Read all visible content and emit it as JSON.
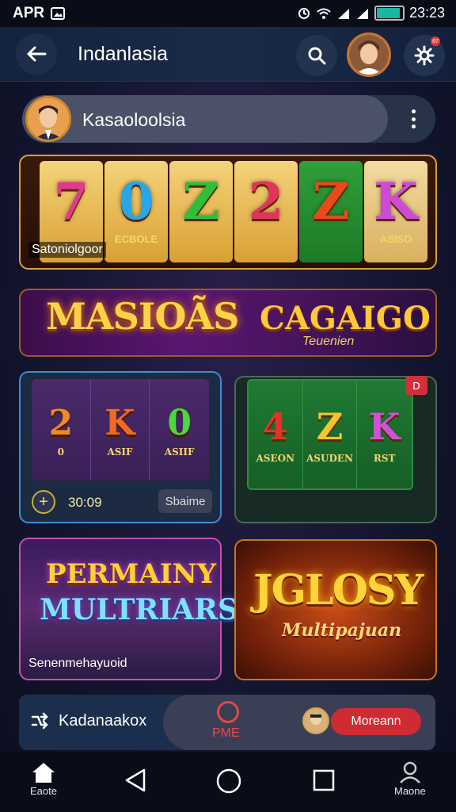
{
  "status_bar": {
    "carrier": "APR",
    "time": "23:23",
    "battery_level": 0.9
  },
  "header": {
    "title": "Indanlasia",
    "notification_count": "67"
  },
  "profile": {
    "name": "Kasaoloolsia"
  },
  "slot_banner": {
    "symbols": [
      "7",
      "0",
      "Z",
      "2",
      "Z",
      "K"
    ],
    "symbol_colors": [
      "#e23a8a",
      "#27a7e8",
      "#2fbf3a",
      "#e2335a",
      "#e84a1a",
      "#d04ad8"
    ],
    "sub_texts": [
      "",
      "ECBOLE",
      "",
      "",
      "",
      "ASISO"
    ],
    "label": "Satoniolgoor"
  },
  "promo_banner": {
    "left_title": "MASIOÃS",
    "right_title": "CAGAIGO",
    "right_subtitle": "Teuenien"
  },
  "tile_a": {
    "reels": [
      {
        "big": "2",
        "color": "#f08a24",
        "small": "0"
      },
      {
        "big": "K",
        "color": "#f06a24",
        "small": "ASIF"
      },
      {
        "big": "0",
        "color": "#4ad83a",
        "small": "ASIIF"
      }
    ],
    "timer": "30:09",
    "button_label": "Sbaime",
    "plus_label": "+"
  },
  "tile_b": {
    "reels": [
      {
        "big": "4",
        "color": "#e2332a",
        "small": "ASEON"
      },
      {
        "big": "Z",
        "color": "#f5c52a",
        "small": "ASUDEN"
      },
      {
        "big": "K",
        "color": "#d050d8",
        "small": "RST"
      }
    ],
    "badge": "D"
  },
  "tile_c": {
    "line1": "PERMAINY",
    "line2": "MULTRIARS",
    "label": "Senenmehayuoid"
  },
  "tile_d": {
    "line1": "JGLOSY",
    "line2": "Multipajuan"
  },
  "bottom_bar": {
    "label": "Kadanaakox",
    "center_label": "PME",
    "button_label": "Moreann"
  },
  "nav": {
    "home_label": "Eaote",
    "profile_label": "Maone"
  },
  "colors": {
    "accent_red": "#cf2b33",
    "gold": "#d7a03c",
    "header_bg": "#14233d"
  },
  "icons": [
    "back-arrow-icon",
    "search-icon",
    "settings-icon",
    "kebab-menu-icon",
    "home-icon",
    "back-triangle-icon",
    "circle-home-icon",
    "square-recents-icon",
    "person-icon"
  ]
}
